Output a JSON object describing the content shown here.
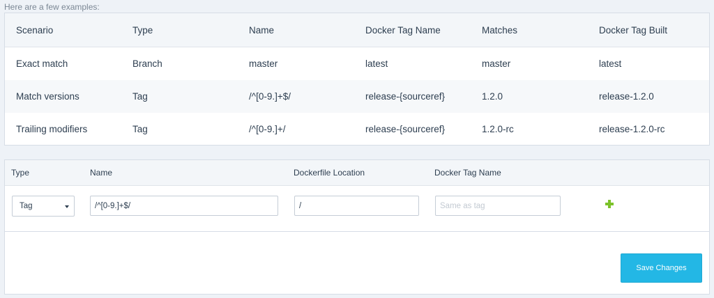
{
  "intro_text": "Here are a few examples:",
  "examples": {
    "headers": [
      "Scenario",
      "Type",
      "Name",
      "Docker Tag Name",
      "Matches",
      "Docker Tag Built"
    ],
    "rows": [
      [
        "Exact match",
        "Branch",
        "master",
        "latest",
        "master",
        "latest"
      ],
      [
        "Match versions",
        "Tag",
        "/^[0-9.]+$/",
        "release-{sourceref}",
        "1.2.0",
        "release-1.2.0"
      ],
      [
        "Trailing modifiers",
        "Tag",
        "/^[0-9.]+/",
        "release-{sourceref}",
        "1.2.0-rc",
        "release-1.2.0-rc"
      ]
    ]
  },
  "editor": {
    "headers": {
      "type": "Type",
      "name": "Name",
      "dockerfile_location": "Dockerfile Location",
      "docker_tag_name": "Docker Tag Name"
    },
    "row": {
      "type_value": "Tag",
      "name_value": "/^[0-9.]+$/",
      "dockerfile_location_value": "/",
      "docker_tag_name_value": "",
      "docker_tag_name_placeholder": "Same as tag"
    },
    "add_icon": "plus-icon",
    "add_color": "#7cc22a"
  },
  "footer": {
    "save_label": "Save Changes",
    "save_color": "#23b7e5"
  }
}
